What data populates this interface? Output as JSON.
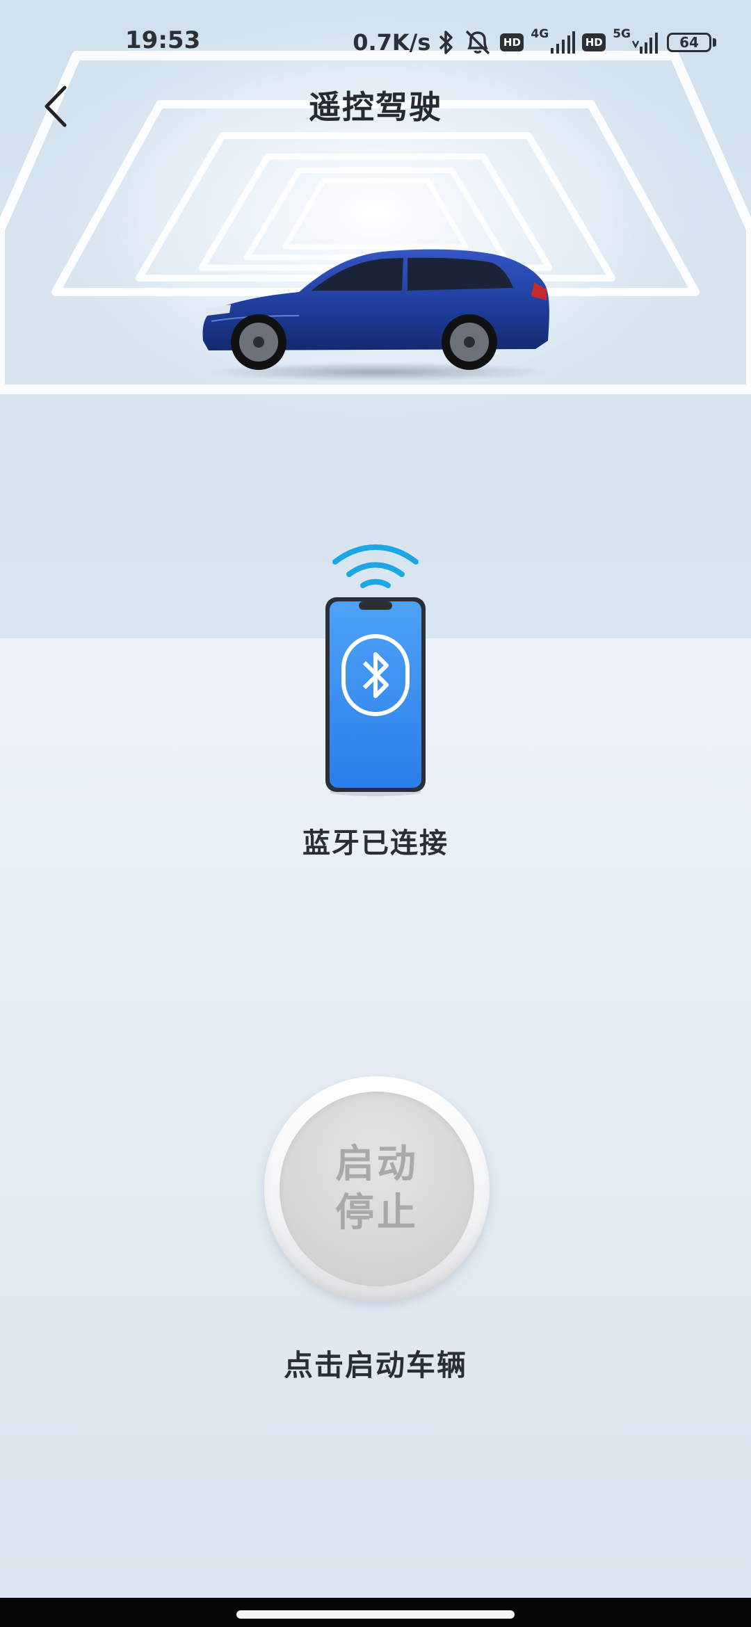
{
  "status_bar": {
    "time": "19:53",
    "net_speed": "0.7K/s",
    "hd_label": "HD",
    "network_1": "4G",
    "network_2": "5G",
    "battery": "64",
    "icons": [
      "bluetooth-icon",
      "mute-icon",
      "signal-icon",
      "battery-icon"
    ]
  },
  "header": {
    "title": "遥控驾驶",
    "back_icon": "chevron-left-icon"
  },
  "connection": {
    "status": "蓝牙已连接",
    "icon": "bluetooth-icon",
    "accent_color": "#2f8df0"
  },
  "control": {
    "button_line_1": "启动",
    "button_line_2": "停止",
    "hint": "点击启动车辆"
  },
  "colors": {
    "car_body": "#1f3f9e",
    "wave": "#1da5e4",
    "button_text": "#a9a9ab"
  }
}
